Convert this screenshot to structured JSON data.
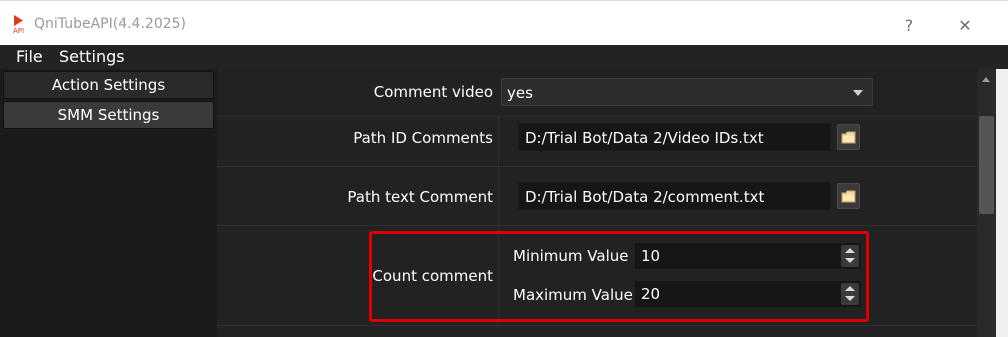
{
  "window": {
    "title": "QniTubeAPI(4.4.2025)",
    "help_glyph": "?",
    "close_glyph": "✕"
  },
  "menu": {
    "items": [
      "File",
      "Settings"
    ]
  },
  "sidebar": {
    "items": [
      {
        "label": "Action Settings",
        "active": false
      },
      {
        "label": "SMM Settings",
        "active": true
      }
    ]
  },
  "form": {
    "comment_video": {
      "label": "Comment video",
      "value": "yes"
    },
    "path_id_comments": {
      "label": "Path ID Comments",
      "value": "D:/Trial Bot/Data 2/Video IDs.txt"
    },
    "path_text_comment": {
      "label": "Path text Comment",
      "value": "D:/Trial Bot/Data 2/comment.txt"
    },
    "count_comment": {
      "label": "Count comment",
      "minimum": {
        "label": "Minimum Value",
        "value": "10"
      },
      "maximum": {
        "label": "Maximum Value",
        "value": "20"
      }
    }
  },
  "colors": {
    "highlight": "#e00000",
    "background": "#1b1b1b",
    "panel": "#222222"
  }
}
